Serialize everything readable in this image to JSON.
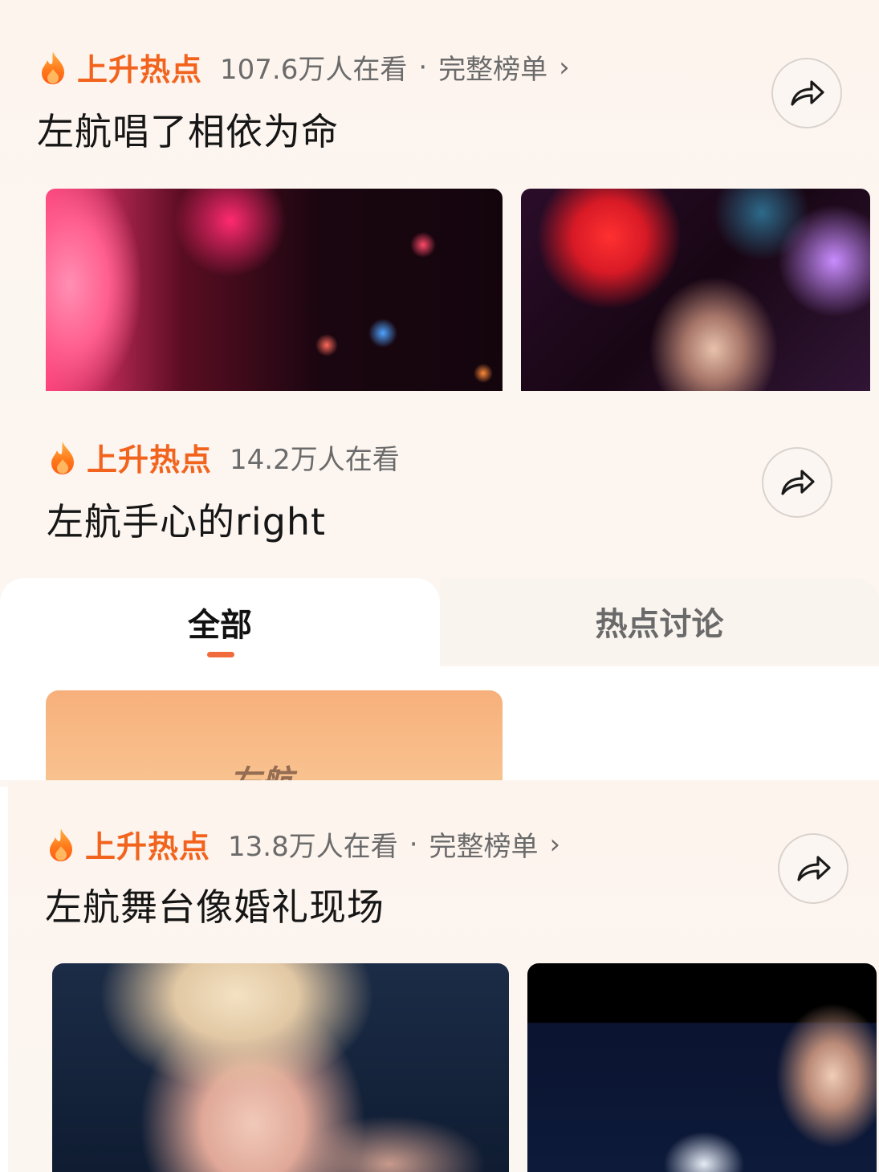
{
  "colors": {
    "hot_orange": "#f2641e",
    "text_dark": "#161616",
    "text_gray": "#6b6b6b",
    "tab_indicator": "#f06a3c"
  },
  "cards": [
    {
      "hot_label": "上升热点",
      "viewers": "107.6万人在看",
      "separator": "·",
      "full_list": "完整榜单",
      "chevron": "›",
      "headline": "左航唱了相依为命",
      "share_icon": "share-arrow-icon"
    },
    {
      "hot_label": "上升热点",
      "viewers": "14.2万人在看",
      "headline": "左航手心的right",
      "share_icon": "share-arrow-icon"
    },
    {
      "hot_label": "上升热点",
      "viewers": "13.8万人在看",
      "separator": "·",
      "full_list": "完整榜单",
      "chevron": "›",
      "headline": "左航舞台像婚礼现场",
      "share_icon": "share-arrow-icon"
    }
  ],
  "tabs": [
    {
      "label": "全部",
      "active": true
    },
    {
      "label": "热点讨论",
      "active": false
    }
  ],
  "thumb_overlay_text": "左航"
}
